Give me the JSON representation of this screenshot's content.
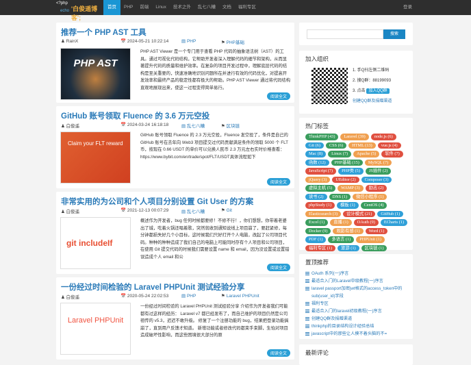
{
  "nav": {
    "logo_php": "<?php",
    "logo_echo": "echo",
    "site_name": "'白俊遥博客';",
    "items": [
      "首页",
      "PHP",
      "前端",
      "Linux",
      "技术之外",
      "乱七八糟",
      "文档",
      "福利专区"
    ],
    "login": "登录"
  },
  "posts": [
    {
      "title": "推荐一个 PHP AST 工具",
      "author": "RainX",
      "date": "2024-05-21 10:22:14",
      "category": "PHP",
      "tags": "PHP基础",
      "thumb": "PHP AST",
      "excerpt": "PHP AST Viewer 是一个专门用于查看 PHP 代码的抽象语法树（AST）的工具。通过可视化代码结构，它帮助开发者深入理解代码的细节和架构，从而显著提升代码的质量和维护效率。在复杂的项目开发过程中，理解底层代码的结构是至关重要的，快速准确地识别问题所在并进行有效的代码优化，对提高开发效率和最终产品的稳定性都有极大的帮助。PHP AST Viewer 通过将代码结构直观地展现出来，使这一过程变得简单易行。",
      "more": "阅读全文"
    },
    {
      "title": "GitHub 账号领取 Fluence 的 3.6 万元空投",
      "author": "白俊遥",
      "date": "2024-03-24 16:18:18",
      "category": "乱七八糟",
      "tags": "区块链",
      "thumb": "Claim your FLT reward",
      "excerpt": "GitHub 账号领取 Fluence 的 2.3 万元空投，Fluence 发空投了，条件是自己的 GitHub 账号在去年向 Web3 项目提交过代码贡献满足条件的领取 5000 个 FLT 币，按现在 0.66 USDT 的单价可以兑换人民币 2.3 万元左右实时价格查看：https://www.bybit.com/en/trade/spot/FLT/USDT具体流程如下",
      "more": "阅读全文"
    },
    {
      "title": "非常实用的为公司和个人项目分别设置 Git User 的方案",
      "author": "白俊遥",
      "date": "2021-12-13 00:07:29",
      "category": "乱七八糟",
      "tags": "Git",
      "thumb": "git includeIf",
      "excerpt": "概述作为开发者，bug 任何时候都要修！不修不行！，你们想想，你带着老婆出了城，吃着火锅还唱着歌，突然就收到通知说线上项目崩了，要赶紧修，每分钟都损失好几个小目标，这时候我们只好打开个人电脑，改起了公司项目代码。种种的种种造成了我们自己的电脑上可能同时存有个人项目和公司项目，在使用 Git 提交代码的时候我们需要设置 name 和 email，因为没设置或设置错误造成个人 email 和公",
      "more": "阅读全文"
    },
    {
      "title": "一份经过时间检验的 Laravel PHPUnit 测试经验分享",
      "author": "白俊遥",
      "date": "2020-05-24 22:02:53",
      "category": "PHP",
      "tags": "Laravel  PHPUnit",
      "thumb": "Laravel PHPUnit",
      "excerpt": "一份经过时间检验的 Laravel PHPUnit 测试经验分享 介绍作为开发者我们可能都有过这样的经历： Laravel v7 都已经发布了，而自己维护的项目仍然是公司祖传的 v5.3，迟迟不敢升级。 修复了一个注册功能的 bug，结果把登录功能搞崩了，直到用户反馈才知道。 新增功能或者修改代码都束手束脚，生怕对项目造成破坏性影响，而这些困境很大部分的原",
      "more": "阅读全文"
    }
  ],
  "sidebar": {
    "search_button": "搜索",
    "join": {
      "title": "加入组织",
      "step1": "1. 手Q扫左侧二维码",
      "step2": "2. 搜Q群：88199093",
      "step3": "3. 点击",
      "qq_button": "加入QQ群",
      "link": "创建QQ群及捐赠渠道"
    },
    "tags_title": "热门标签",
    "tags": [
      {
        "t": "ThinkPHP (43)",
        "c": "#3a9d5d"
      },
      {
        "t": "Laravel (39)",
        "c": "#f0a050"
      },
      {
        "t": "node.js (6)",
        "c": "#e05040"
      },
      {
        "t": "Git (6)",
        "c": "#30a0d8"
      },
      {
        "t": "CSS (6)",
        "c": "#3a9d5d"
      },
      {
        "t": "HTML (13)",
        "c": "#f0a050"
      },
      {
        "t": "vue.js (4)",
        "c": "#e05040"
      },
      {
        "t": "Mac (8)",
        "c": "#30a0d8"
      },
      {
        "t": "Linux (7)",
        "c": "#3a9d5d"
      },
      {
        "t": "Apache (5)",
        "c": "#f0a050"
      },
      {
        "t": "软件 (7)",
        "c": "#e05040"
      },
      {
        "t": "函数 (12)",
        "c": "#30a0d8"
      },
      {
        "t": "PHP基础 (15)",
        "c": "#3a9d5d"
      },
      {
        "t": "MySQL (7)",
        "c": "#f0a050"
      },
      {
        "t": "JavaScript (7)",
        "c": "#e05040"
      },
      {
        "t": "PHP类 (5)",
        "c": "#30a0d8"
      },
      {
        "t": "JS插件 (2)",
        "c": "#3a9d5d"
      },
      {
        "t": "jQuery (3)",
        "c": "#f0a050"
      },
      {
        "t": "UEditor (2)",
        "c": "#e05040"
      },
      {
        "t": "Composer (3)",
        "c": "#30a0d8"
      },
      {
        "t": "虚拟主机 (5)",
        "c": "#3a9d5d"
      },
      {
        "t": "WAMP (3)",
        "c": "#f0a050"
      },
      {
        "t": "励志 (2)",
        "c": "#e05040"
      },
      {
        "t": "读书 (2)",
        "c": "#30a0d8"
      },
      {
        "t": "DNS (1)",
        "c": "#3a9d5d"
      },
      {
        "t": "微信小程序 (1)",
        "c": "#f0a050"
      },
      {
        "t": "phpStudy (1)",
        "c": "#e05040"
      },
      {
        "t": "模板 (1)",
        "c": "#30a0d8"
      },
      {
        "t": "CentOS (4)",
        "c": "#3a9d5d"
      },
      {
        "t": "Elasticsearch (3)",
        "c": "#f0a050"
      },
      {
        "t": "设计模式 (21)",
        "c": "#e05040"
      },
      {
        "t": "GitHub (1)",
        "c": "#30a0d8"
      },
      {
        "t": "Excel (1)",
        "c": "#3a9d5d"
      },
      {
        "t": "直播 (1)",
        "c": "#f0a050"
      },
      {
        "t": "OAuth (9)",
        "c": "#e05040"
      },
      {
        "t": "ECharts (1)",
        "c": "#30a0d8"
      },
      {
        "t": "Docker (9)",
        "c": "#3a9d5d"
      },
      {
        "t": "观影有感 (1)",
        "c": "#f0a050"
      },
      {
        "t": "Word (1)",
        "c": "#e05040"
      },
      {
        "t": "PDF (1)",
        "c": "#30a0d8"
      },
      {
        "t": "多语言 (1)",
        "c": "#3a9d5d"
      },
      {
        "t": "PHPUnit (1)",
        "c": "#f0a050"
      },
      {
        "t": "福利专区 (1)",
        "c": "#e05040"
      },
      {
        "t": "旅游 (1)",
        "c": "#30a0d8"
      },
      {
        "t": "区块链 (1)",
        "c": "#3a9d5d"
      }
    ],
    "rec_title": "置顶推荐",
    "rec": [
      "OAuth 系列(一)序言",
      "最适合入门的Laravel中级教程(一)序言",
      "laravel passport加密jwt格式的access_token中的sub(user_id)字段",
      "福利专区",
      "最适合入门的laravel初级教程(一)序言",
      "创建QQ群及捐赠渠道",
      "thinkphp的目录结构设计经验总结",
      "javascript中的那些让人摸不着头脑的不="
    ],
    "comments_title": "最新评论"
  }
}
